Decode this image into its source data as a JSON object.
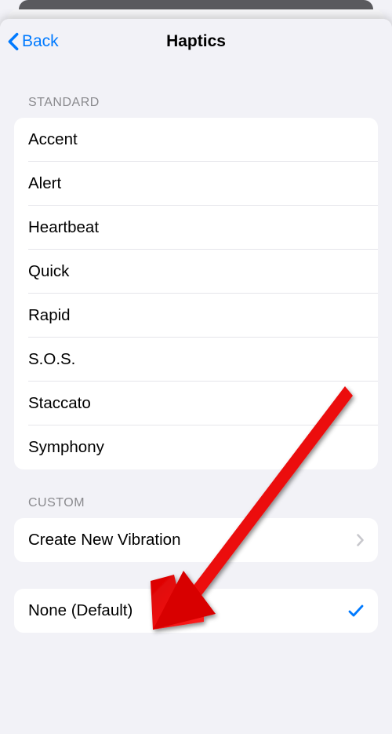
{
  "nav": {
    "back_label": "Back",
    "title": "Haptics"
  },
  "sections": {
    "standard": {
      "header": "STANDARD",
      "items": [
        {
          "label": "Accent"
        },
        {
          "label": "Alert"
        },
        {
          "label": "Heartbeat"
        },
        {
          "label": "Quick"
        },
        {
          "label": "Rapid"
        },
        {
          "label": "S.O.S."
        },
        {
          "label": "Staccato"
        },
        {
          "label": "Symphony"
        }
      ]
    },
    "custom": {
      "header": "CUSTOM",
      "create_label": "Create New Vibration"
    },
    "default": {
      "none_label": "None (Default)"
    }
  },
  "colors": {
    "tint": "#007aff"
  }
}
